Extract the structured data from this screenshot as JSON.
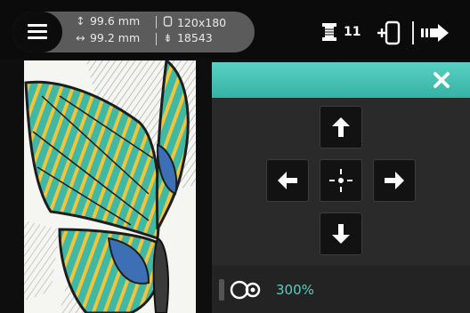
{
  "header": {
    "menu_icon": "hamburger-icon",
    "height_value": "99.6 mm",
    "width_value": "99.2 mm",
    "hoop_size": "120x180",
    "stitch_count": "18543",
    "color_count": "11",
    "icons": {
      "height": "vertical-arrow-icon",
      "width": "horizontal-arrow-icon",
      "hoop": "hoop-icon",
      "stitches": "stitch-icon",
      "thread": "bobbin-icon",
      "frame": "frame-icon",
      "next": "next-arrow-icon"
    }
  },
  "preview": {
    "image": "butterfly-embroidery-design",
    "colors": {
      "teal": "#3fb8a6",
      "yellow": "#f0c53b",
      "blue": "#3c6fb3",
      "outline": "#1d1d1d",
      "stitch": "#b5b5b5"
    }
  },
  "move_panel": {
    "header_color": "#40bfb1",
    "close_icon": "close-icon",
    "buttons": [
      "arrow-up-icon",
      "arrow-left-icon",
      "center-icon",
      "arrow-right-icon",
      "arrow-down-icon"
    ]
  },
  "zoom": {
    "value": "300%",
    "icon": "zoom-icon"
  }
}
